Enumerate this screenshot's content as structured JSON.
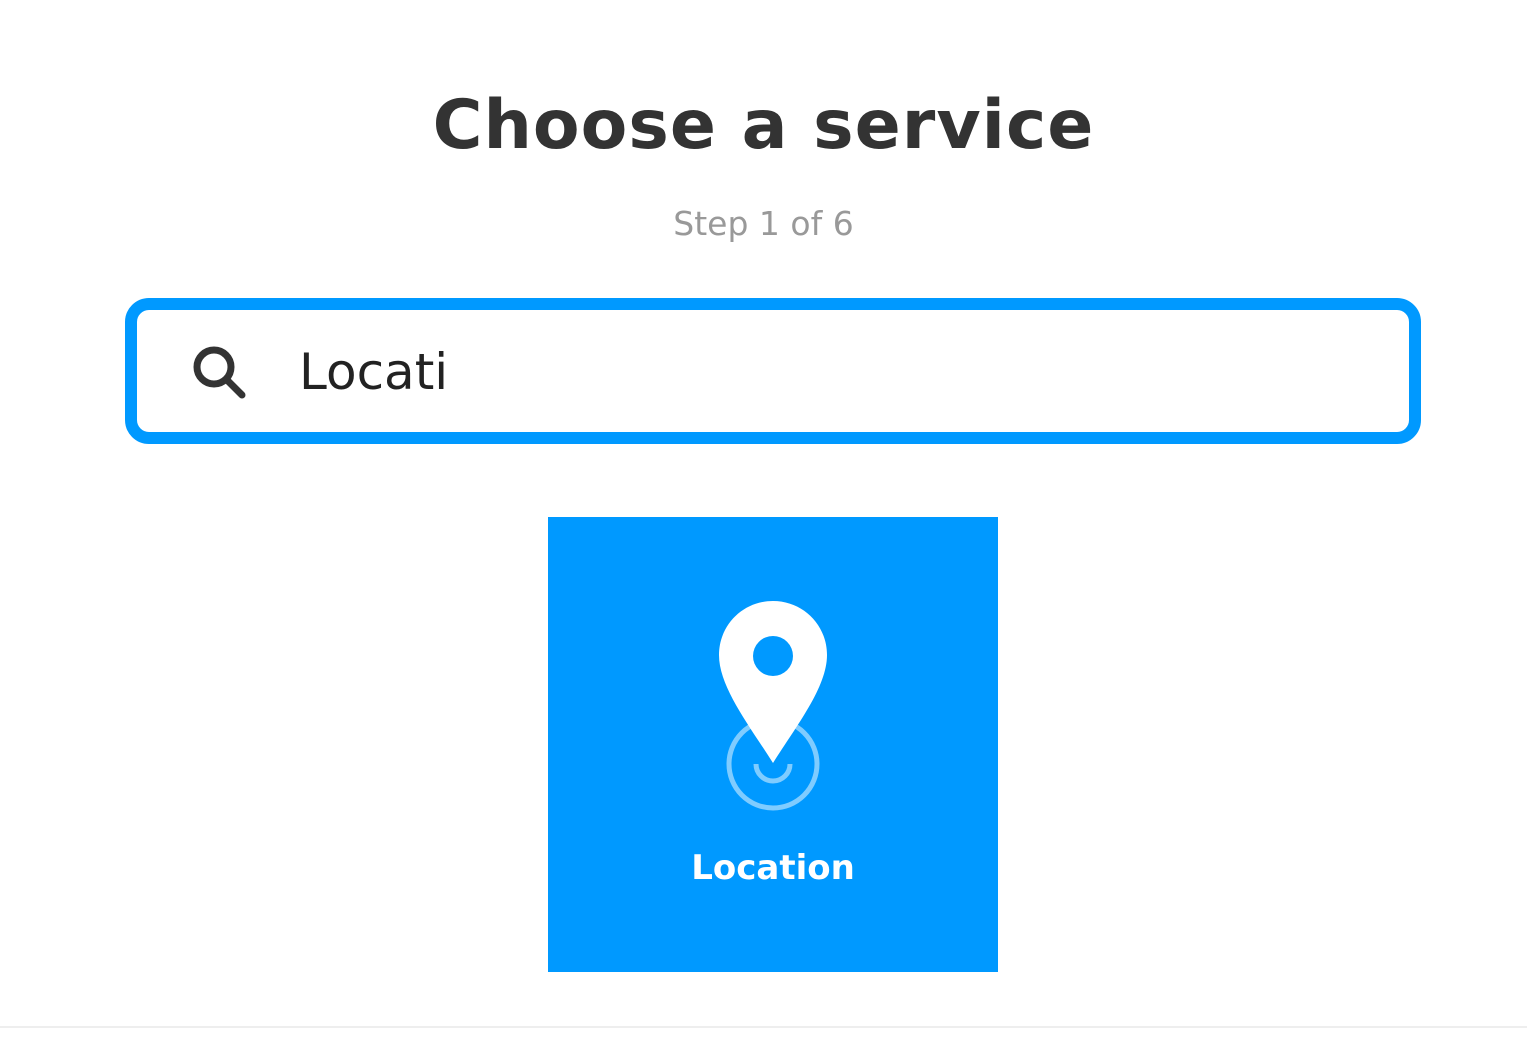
{
  "header": {
    "title": "Choose a service",
    "step": "Step 1 of 6"
  },
  "search": {
    "value": "Locati",
    "placeholder": "",
    "icon": "search-icon",
    "border_color": "#0099ff"
  },
  "results": [
    {
      "label": "Location",
      "icon": "location-pin-icon",
      "background_color": "#0099ff"
    }
  ]
}
